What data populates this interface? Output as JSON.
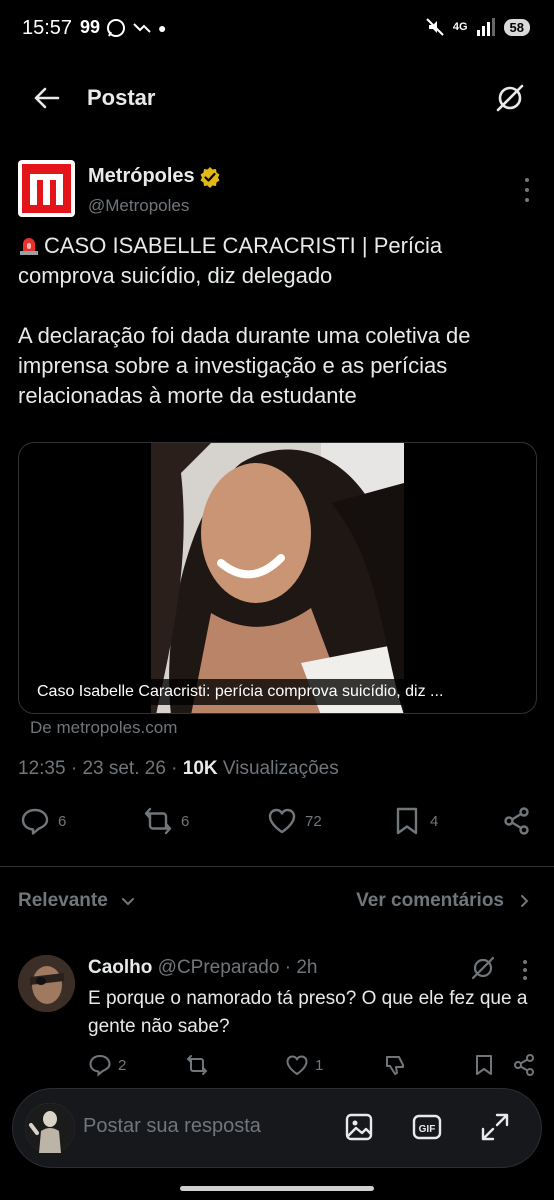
{
  "status_bar": {
    "time": "15:57",
    "left_icons": "99",
    "network": "4G",
    "battery": "58"
  },
  "header": {
    "title": "Postar"
  },
  "tweet": {
    "author_name": "Metrópoles",
    "author_handle": "@Metropoles",
    "headline": "CASO ISABELLE CARACRISTI | Perícia comprova suicídio, diz delegado",
    "body": "A declaração foi dada durante uma coletiva de imprensa sobre a investigação e as perícias relacionadas à morte da estudante",
    "card_caption": "Caso Isabelle Caracristi: perícia comprova suicídio, diz ...",
    "card_source": "De metropoles.com",
    "time": "12:35",
    "date": "23 set. 26",
    "views_count": "10K",
    "views_label": "Visualizações",
    "replies": "6",
    "reposts": "6",
    "likes": "72",
    "bookmarks": "4"
  },
  "sort": {
    "left_label": "Relevante",
    "right_label": "Ver comentários"
  },
  "reply": {
    "name": "Caolho",
    "handle": "@CPreparado",
    "age": "2h",
    "text": "E porque o namorado tá preso? O que ele fez que a gente não sabe?",
    "replies": "2",
    "reposts": "",
    "likes": "1"
  },
  "composer": {
    "placeholder": "Postar sua resposta"
  }
}
